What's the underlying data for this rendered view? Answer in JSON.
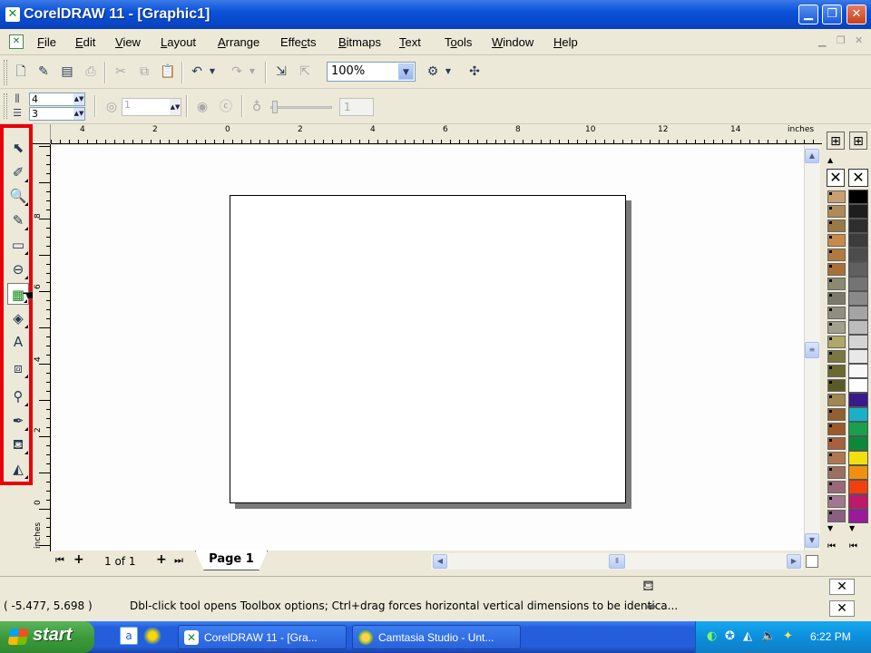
{
  "window": {
    "title": "CorelDRAW 11 - [Graphic1]",
    "app_icon": "coreldraw-icon"
  },
  "menu": [
    "File",
    "Edit",
    "View",
    "Layout",
    "Arrange",
    "Effects",
    "Bitmaps",
    "Text",
    "Tools",
    "Window",
    "Help"
  ],
  "menu_underline": [
    "F",
    "E",
    "V",
    "L",
    "A",
    "c",
    "B",
    "T",
    "o",
    "W",
    "H"
  ],
  "standard_toolbar": {
    "zoom_value": "100%"
  },
  "property_bar": {
    "columns": "4",
    "rows": "3",
    "spiral_revolutions": "1",
    "expansion_value": "1"
  },
  "ruler": {
    "unit": "inches",
    "h_labels": [
      "4",
      "2",
      "0",
      "2",
      "4",
      "6",
      "8",
      "10",
      "12",
      "14"
    ],
    "v_labels": [
      "8",
      "6",
      "4",
      "2",
      "0"
    ],
    "v_unit": "inches"
  },
  "page_nav": {
    "count": "1 of 1",
    "tab": "Page 1"
  },
  "status": {
    "coords": "( -5.477, 5.698  )",
    "hint": "Dbl-click tool opens Toolbox options; Ctrl+drag forces horizontal  vertical dimensions to be identica..."
  },
  "taskbar": {
    "start_label": "start",
    "tasks": [
      {
        "label": "CorelDRAW 11 - [Gra...",
        "icon": "coreldraw-icon"
      },
      {
        "label": "Camtasia Studio - Unt...",
        "icon": "camtasia-icon"
      }
    ],
    "clock": "6:22 PM"
  },
  "palette_colors": [
    "#c8a070",
    "#b08a58",
    "#9b7848",
    "#c88a4a",
    "#b07a3e",
    "#a87038",
    "#8a8a70",
    "#7a7a6a",
    "#8f8f80",
    "#a0a090",
    "#b0a868",
    "#787840",
    "#6a6a30",
    "#5a5a28",
    "#a08850",
    "#906030",
    "#9a5a2a",
    "#a86040",
    "#b07850",
    "#9a7060",
    "#9a6878",
    "#a07890",
    "#8a6080"
  ],
  "palette_right": [
    "#000000",
    "#1e1e1e",
    "#2e2e2e",
    "#3c3c3c",
    "#4c4c4c",
    "#606060",
    "#747474",
    "#8a8a8a",
    "#a4a4a4",
    "#bcbcbc",
    "#d4d4d4",
    "#e8e8e8",
    "#f8f8f8",
    "#ffffff",
    "#3a1a8a",
    "#1ab0c8",
    "#18a04a",
    "#0a8a38",
    "#f0e010",
    "#f09010",
    "#f04010",
    "#c0186a",
    "#9a1a9a"
  ]
}
